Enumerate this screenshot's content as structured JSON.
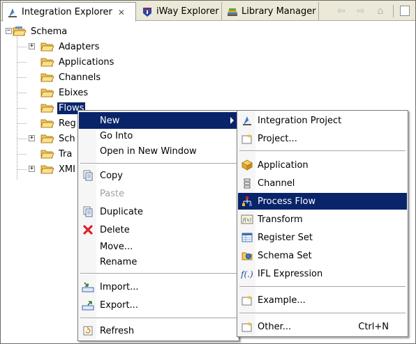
{
  "tabs": [
    {
      "label": "Integration Explorer",
      "icon": "integration-explorer-icon",
      "active": true,
      "close_glyph": "✕"
    },
    {
      "label": "iWay Explorer",
      "icon": "iway-icon",
      "active": false
    },
    {
      "label": "Library Manager",
      "icon": "library-manager-icon",
      "active": false
    }
  ],
  "toolbar": {
    "back_glyph": "⇦",
    "forward_glyph": "⇨",
    "home_glyph": "⌂"
  },
  "tree": {
    "root": {
      "label": "Schema",
      "expander": "−"
    },
    "children": [
      {
        "label": "Adapters",
        "expander": "+"
      },
      {
        "label": "Applications",
        "expander": ""
      },
      {
        "label": "Channels",
        "expander": ""
      },
      {
        "label": "Ebixes",
        "expander": ""
      },
      {
        "label": "Flows",
        "expander": "",
        "selected": true
      },
      {
        "label": "Reg",
        "expander": ""
      },
      {
        "label": "Sch",
        "expander": "+"
      },
      {
        "label": "Tra",
        "expander": ""
      },
      {
        "label": "XMI",
        "expander": "+"
      }
    ]
  },
  "context_menu": {
    "items": [
      {
        "label": "New",
        "icon": "",
        "submenu": true,
        "highlighted": true
      },
      {
        "label": "Go Into",
        "icon": ""
      },
      {
        "label": "Open in New Window",
        "icon": ""
      },
      {
        "separator": true
      },
      {
        "label": "Copy",
        "icon": "copy-icon"
      },
      {
        "label": "Paste",
        "icon": "",
        "disabled": true
      },
      {
        "label": "Duplicate",
        "icon": "duplicate-icon"
      },
      {
        "label": "Delete",
        "icon": "delete-icon"
      },
      {
        "label": "Move...",
        "icon": ""
      },
      {
        "label": "Rename",
        "icon": ""
      },
      {
        "separator": true
      },
      {
        "label": "Import...",
        "icon": "import-icon"
      },
      {
        "label": "Export...",
        "icon": "export-icon"
      },
      {
        "separator": true
      },
      {
        "label": "Refresh",
        "icon": "refresh-icon"
      }
    ]
  },
  "submenu": {
    "items": [
      {
        "label": "Integration Project",
        "icon": "integration-project-icon"
      },
      {
        "label": "Project...",
        "icon": "project-icon"
      },
      {
        "separator": true
      },
      {
        "label": "Application",
        "icon": "application-icon"
      },
      {
        "label": "Channel",
        "icon": "channel-icon"
      },
      {
        "label": "Process Flow",
        "icon": "process-flow-icon",
        "highlighted": true
      },
      {
        "label": "Transform",
        "icon": "transform-icon"
      },
      {
        "label": "Register Set",
        "icon": "register-set-icon"
      },
      {
        "label": "Schema Set",
        "icon": "schema-set-icon"
      },
      {
        "label": "IFL Expression",
        "icon": "ifl-expression-icon"
      },
      {
        "separator": true
      },
      {
        "label": "Example...",
        "icon": "example-icon"
      },
      {
        "separator": true
      },
      {
        "label": "Other...",
        "icon": "other-icon",
        "accelerator": "Ctrl+N"
      }
    ]
  },
  "colors": {
    "selection": "#0a246a",
    "tabbar_bg": "#ece9d8",
    "folder": "#f2c65a"
  }
}
